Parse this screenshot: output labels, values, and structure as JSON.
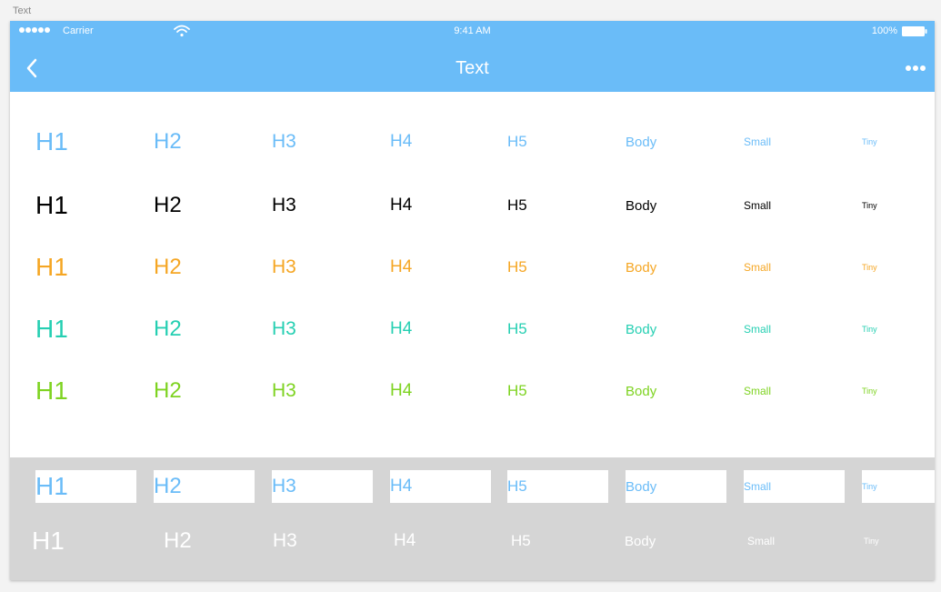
{
  "page_label": "Text",
  "status_bar": {
    "carrier": "Carrier",
    "time": "9:41 AM",
    "battery": "100%"
  },
  "nav": {
    "title": "Text"
  },
  "labels": [
    "H1",
    "H2",
    "H3",
    "H4",
    "H5",
    "Body",
    "Small",
    "Tiny"
  ],
  "colors": {
    "blue": "#6ABCF8",
    "black": "#000000",
    "orange": "#F5A623",
    "teal": "#25CFB2",
    "green": "#7ED321",
    "white": "#FFFFFF",
    "gray_panel": "#D5D5D5"
  },
  "row_colors": [
    "blue",
    "black",
    "orange",
    "teal",
    "green"
  ]
}
